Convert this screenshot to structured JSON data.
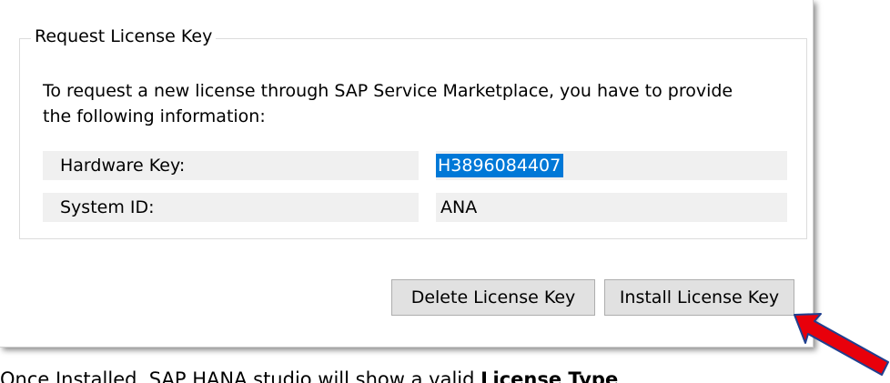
{
  "group": {
    "title": "Request License Key",
    "description": "To request a new license through SAP Service Marketplace, you have to provide the following information:"
  },
  "fields": {
    "hardware_key": {
      "label": "Hardware Key:",
      "value": "H3896084407"
    },
    "system_id": {
      "label": "System ID:",
      "value": "ANA"
    }
  },
  "buttons": {
    "delete_label": "Delete License Key",
    "install_label": "Install License Key"
  },
  "caption": {
    "prefix": "Once Installed, SAP HANA studio will show a valid ",
    "bold": "License Type"
  },
  "colors": {
    "selection": "#0078d7",
    "arrow_fill": "#e8000b",
    "arrow_stroke": "#1f3f8f"
  },
  "icons": {
    "callout": "red-arrow-icon"
  }
}
